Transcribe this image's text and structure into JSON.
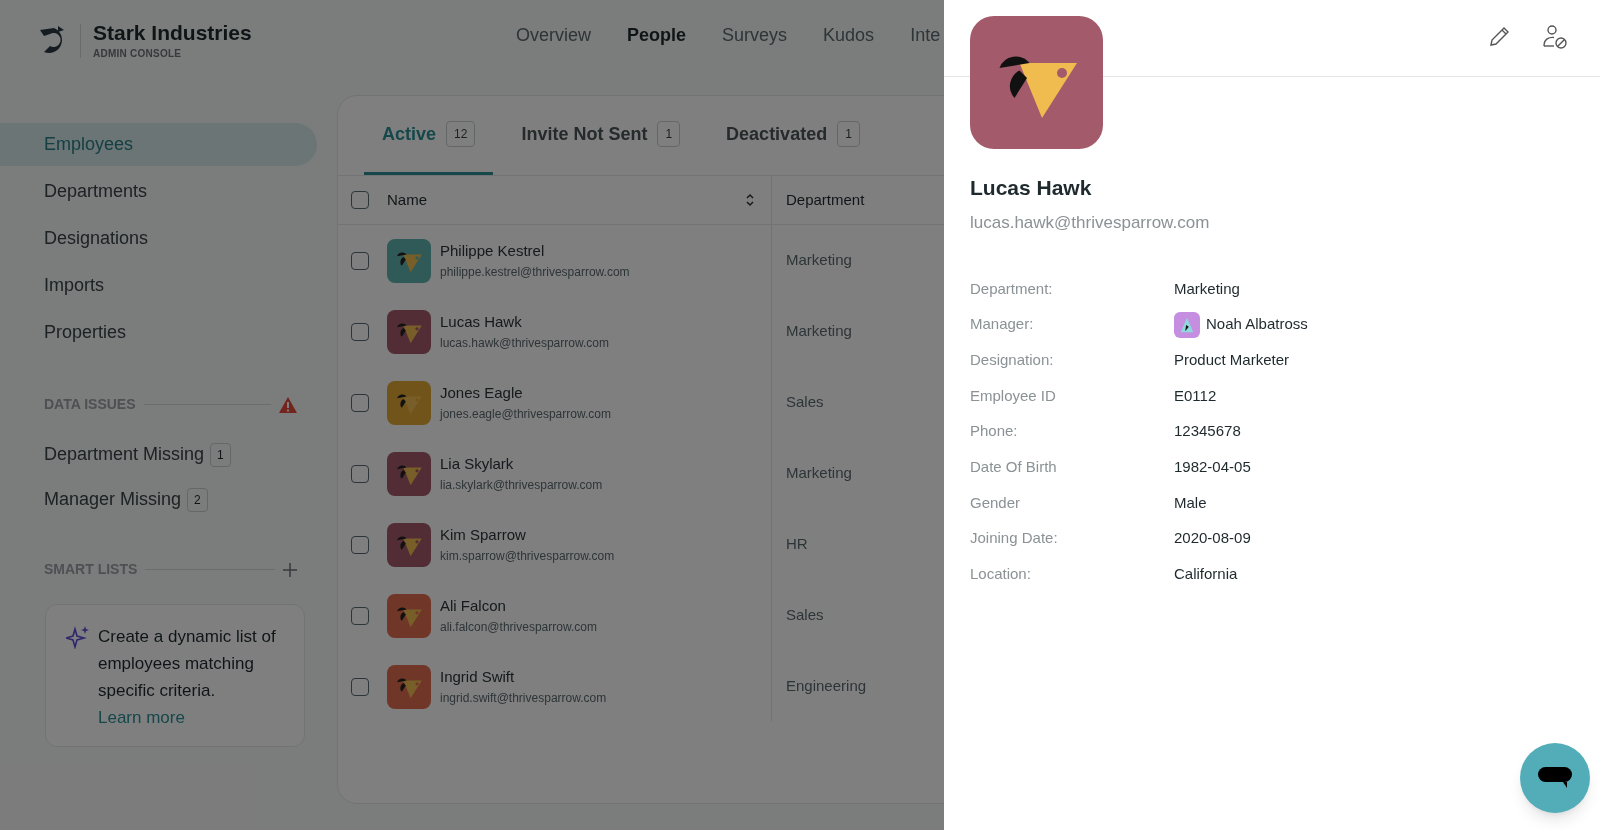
{
  "header": {
    "brand": "Stark Industries",
    "subtitle": "ADMIN CONSOLE",
    "nav": [
      {
        "label": "Overview",
        "selected": false
      },
      {
        "label": "People",
        "selected": true
      },
      {
        "label": "Surveys",
        "selected": false
      },
      {
        "label": "Kudos",
        "selected": false
      },
      {
        "label": "Inte",
        "selected": false
      }
    ]
  },
  "sidebar": {
    "items": [
      {
        "label": "Employees",
        "selected": true
      },
      {
        "label": "Departments",
        "selected": false
      },
      {
        "label": "Designations",
        "selected": false
      },
      {
        "label": "Imports",
        "selected": false
      },
      {
        "label": "Properties",
        "selected": false
      }
    ],
    "data_issues": {
      "title": "DATA ISSUES",
      "items": [
        {
          "label": "Department Missing",
          "count": "1"
        },
        {
          "label": "Manager Missing",
          "count": "2"
        }
      ]
    },
    "smart_lists": {
      "title": "SMART LISTS",
      "card_text": "Create a dynamic list of employees matching specific criteria.",
      "link": "Learn more"
    }
  },
  "tabs": [
    {
      "label": "Active",
      "count": "12",
      "selected": true
    },
    {
      "label": "Invite Not Sent",
      "count": "1",
      "selected": false
    },
    {
      "label": "Deactivated",
      "count": "1",
      "selected": false
    }
  ],
  "table": {
    "columns": [
      "Name",
      "Department"
    ],
    "select_all_checked": false,
    "rows": [
      {
        "name": "Philippe Kestrel",
        "email": "philippe.kestrel@thrivesparrow.com",
        "department": "Marketing",
        "color": "#305a58",
        "checked": false
      },
      {
        "name": "Lucas Hawk",
        "email": "lucas.hawk@thrivesparrow.com",
        "department": "Marketing",
        "color": "#522d36",
        "checked": false
      },
      {
        "name": "Jones Eagle",
        "email": "jones.eagle@thrivesparrow.com",
        "department": "Sales",
        "color": "#70541a",
        "checked": false
      },
      {
        "name": "Lia Skylark",
        "email": "lia.skylark@thrivesparrow.com",
        "department": "Marketing",
        "color": "#522d36",
        "checked": false
      },
      {
        "name": "Kim Sparrow",
        "email": "kim.sparrow@thrivesparrow.com",
        "department": "HR",
        "color": "#522d36",
        "checked": false
      },
      {
        "name": "Ali Falcon",
        "email": "ali.falcon@thrivesparrow.com",
        "department": "Sales",
        "color": "#703628",
        "checked": false
      },
      {
        "name": "Ingrid Swift",
        "email": "ingrid.swift@thrivesparrow.com",
        "department": "Engineering",
        "color": "#703628",
        "checked": false
      }
    ]
  },
  "drawer": {
    "name": "Lucas Hawk",
    "email": "lucas.hawk@thrivesparrow.com",
    "color": "#a35a6b",
    "fields": [
      {
        "label": "Department:",
        "value": "Marketing",
        "kind": "text"
      },
      {
        "label": "Manager:",
        "value": "Noah Albatross",
        "kind": "person",
        "color": "#c58ee0"
      },
      {
        "label": "Designation:",
        "value": "Product Marketer",
        "kind": "text"
      },
      {
        "label": "Employee ID",
        "value": "E0112",
        "kind": "text"
      },
      {
        "label": "Phone:",
        "value": "12345678",
        "kind": "text"
      },
      {
        "label": "Date Of Birth",
        "value": "1982-04-05",
        "kind": "text"
      },
      {
        "label": "Gender",
        "value": "Male",
        "kind": "text"
      },
      {
        "label": "Joining Date:",
        "value": "2020-08-09",
        "kind": "text"
      },
      {
        "label": "Location:",
        "value": "California",
        "kind": "text"
      }
    ]
  }
}
